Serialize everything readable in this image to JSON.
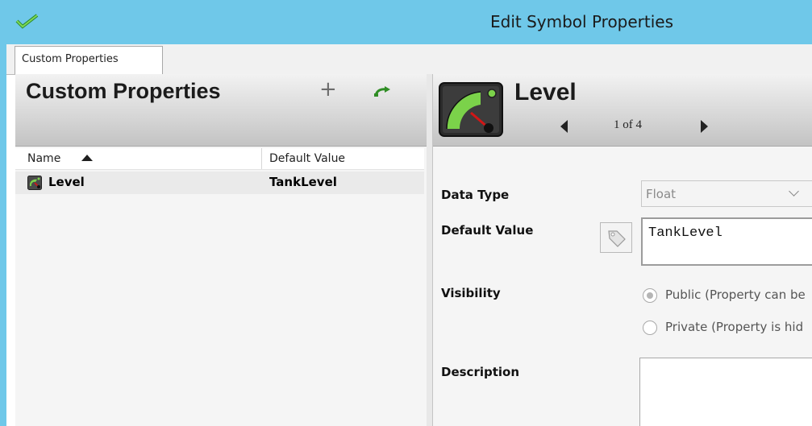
{
  "window": {
    "title": "Edit Symbol Properties",
    "app_icon": "checkmark-icon"
  },
  "tabs": [
    {
      "label": "Custom Properties",
      "active": true
    }
  ],
  "left_panel": {
    "title": "Custom Properties",
    "add_label": "+",
    "add_icon": "plus-icon",
    "revert_icon": "undo-arrow-icon",
    "columns": {
      "name": "Name",
      "default_value": "Default Value",
      "sort": "ascending"
    },
    "rows": [
      {
        "icon": "gauge-icon",
        "name": "Level",
        "default_value": "TankLevel",
        "selected": true
      }
    ]
  },
  "right_panel": {
    "symbol_icon": "gauge-icon",
    "title": "Level",
    "pager": {
      "text": "1 of 4"
    },
    "labels": {
      "data_type": "Data Type",
      "default_value": "Default Value",
      "visibility": "Visibility",
      "description": "Description"
    },
    "data_type_value": "Float",
    "default_value": "TankLevel",
    "tag_icon": "tag-icon",
    "visibility_options": [
      {
        "label": "Public (Property can be",
        "checked": true
      },
      {
        "label": "Private (Property is hid",
        "checked": false
      }
    ],
    "description": ""
  },
  "colors": {
    "titlebar": "#6fc8e9",
    "gauge_green": "#7bd24a",
    "gauge_needle": "#d21616"
  }
}
